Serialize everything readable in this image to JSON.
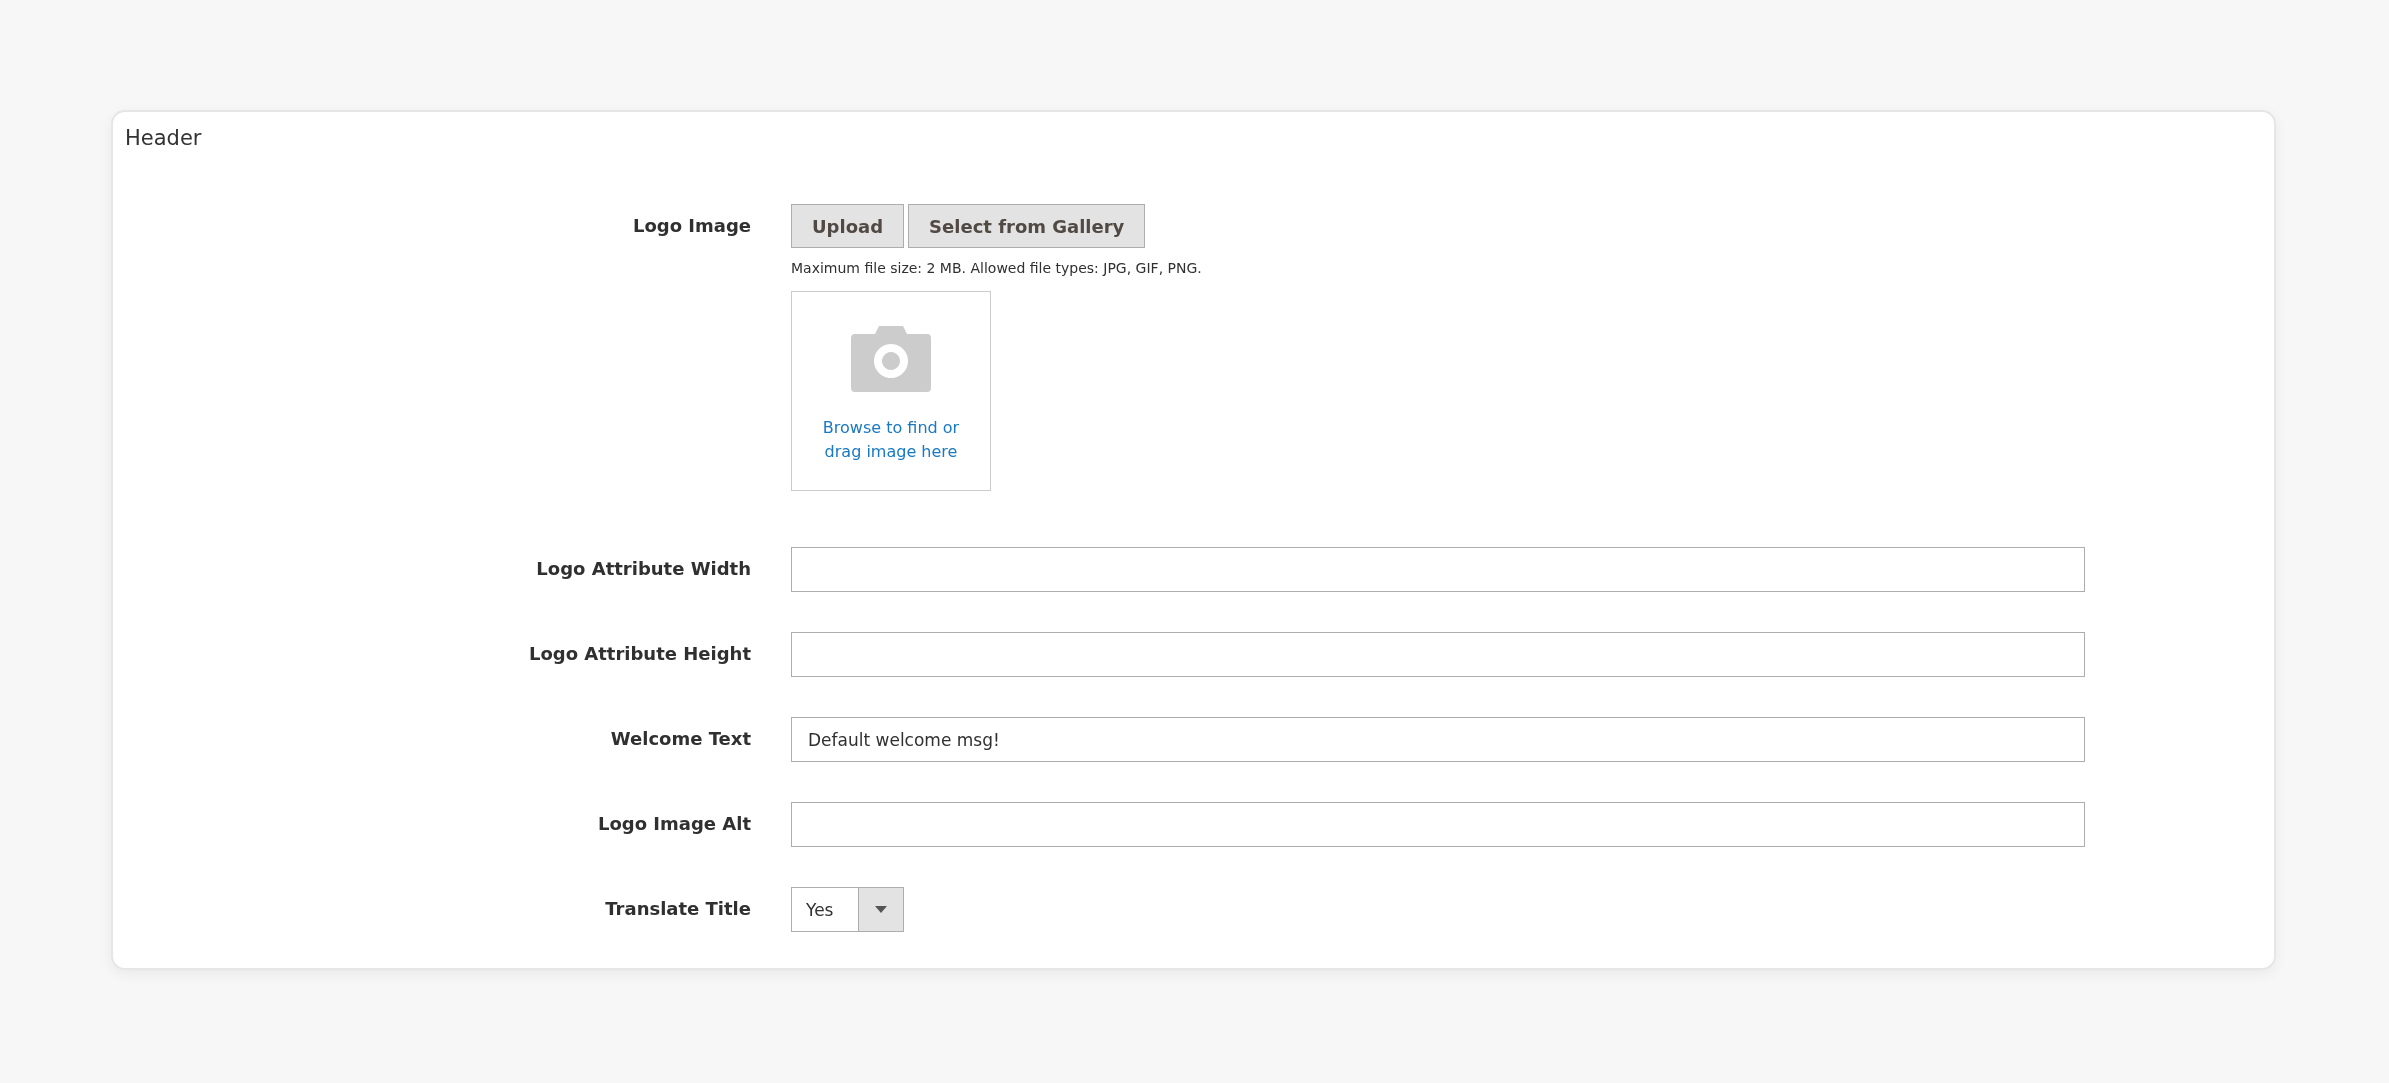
{
  "section": {
    "title": "Header"
  },
  "fields": [
    {
      "kind": "image",
      "label": "Logo Image",
      "buttons": [
        "Upload",
        "Select from Gallery"
      ],
      "note": "Maximum file size: 2 MB. Allowed file types: JPG, GIF, PNG.",
      "dropzone": "Browse to find or drag image here"
    },
    {
      "kind": "text",
      "label": "Logo Attribute Width"
    },
    {
      "kind": "text",
      "label": "Logo Attribute Height"
    },
    {
      "kind": "text",
      "label": "Welcome Text",
      "value": "Default welcome msg!"
    },
    {
      "kind": "text",
      "label": "Logo Image Alt"
    },
    {
      "kind": "select",
      "label": "Translate Title",
      "value": "Yes"
    }
  ]
}
